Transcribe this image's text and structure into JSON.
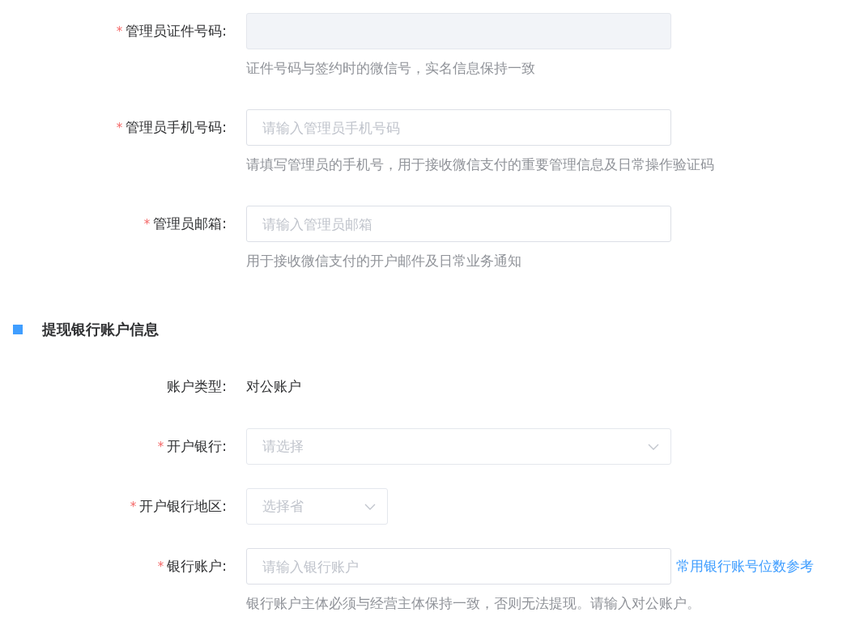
{
  "admin_fields": [
    {
      "kind": "input",
      "label": "管理员证件号码:",
      "required_mark": "*",
      "disabled": true,
      "hint": "证件号码与签约时的微信号，实名信息保持一致"
    },
    {
      "kind": "input",
      "label": "管理员手机号码:",
      "required_mark": "*",
      "disabled": false,
      "placeholder": "请输入管理员手机号码",
      "hint": "请填写管理员的手机号，用于接收微信支付的重要管理信息及日常操作验证码"
    },
    {
      "kind": "input",
      "label": "管理员邮箱:",
      "required_mark": "*",
      "disabled": false,
      "placeholder": "请输入管理员邮箱",
      "hint": "用于接收微信支付的开户邮件及日常业务通知"
    }
  ],
  "bank_section": {
    "title": "提现银行账户信息",
    "fields": [
      {
        "kind": "text",
        "label": "账户类型:",
        "value": "对公账户"
      },
      {
        "kind": "select",
        "label": "开户银行:",
        "required_mark": "*",
        "placeholder": "请选择"
      },
      {
        "kind": "short-select",
        "label": "开户银行地区:",
        "required_mark": "*",
        "placeholder": "选择省"
      },
      {
        "kind": "input",
        "label": "银行账户:",
        "required_mark": "*",
        "disabled": false,
        "placeholder": "请输入银行账户",
        "link": "常用银行账号位数参考",
        "hint": "银行账户主体必须与经营主体保持一致，否则无法提现。请输入对公账户。"
      }
    ]
  }
}
